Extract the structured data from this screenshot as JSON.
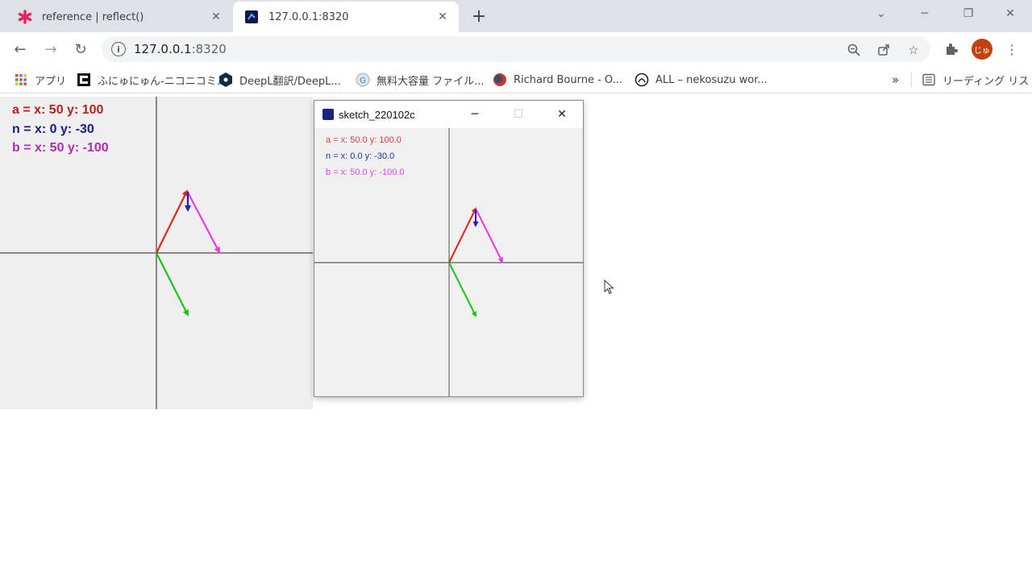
{
  "tabs": [
    {
      "title": "reference | reflect()",
      "favicon": "asterisk-icon",
      "color": "#ed225d"
    },
    {
      "title": "127.0.0.1:8320",
      "favicon": "processing-icon"
    }
  ],
  "address_bar": {
    "host": "127.0.0.1",
    "port": ":8320"
  },
  "avatar": {
    "initials": "じゅ"
  },
  "bookmarks": [
    {
      "label": "アプリ",
      "icon": "apps-grid-icon"
    },
    {
      "label": "ふにゅにゅん-ニコニコミ...",
      "icon": "niconico-icon"
    },
    {
      "label": "DeepL翻訳/DeepL...",
      "icon": "deepl-icon"
    },
    {
      "label": "無料大容量 ファイル...",
      "icon": "gigafile-icon"
    },
    {
      "label": "Richard Bourne - O...",
      "icon": "richard-bourne-icon"
    },
    {
      "label": "ALL – nekosuzu wor...",
      "icon": "nekosuzu-icon"
    }
  ],
  "reading_list": {
    "label": "リーディング リスト"
  },
  "browser_canvas": {
    "labels": [
      {
        "text": "a = x: 50 y: 100",
        "color": "#b22222"
      },
      {
        "text": "n = x: 0 y: -30",
        "color": "#1a1a8c"
      },
      {
        "text": "b = x: 50 y: -100",
        "color": "#b02cb0"
      }
    ]
  },
  "sketch_window": {
    "title": "sketch_220102c",
    "labels": [
      {
        "text": "a = x: 50.0 y: 100.0",
        "color": "#e53935"
      },
      {
        "text": "n = x: 0.0 y: -30.0",
        "color": "#1e2fb0"
      },
      {
        "text": "b = x: 50.0 y: -100.0",
        "color": "#e040fb"
      }
    ]
  },
  "colors": {
    "vec_a": "#e8231a",
    "vec_n": "#1a1ad8",
    "vec_b": "#e83ae8",
    "vec_green": "#19c419"
  }
}
